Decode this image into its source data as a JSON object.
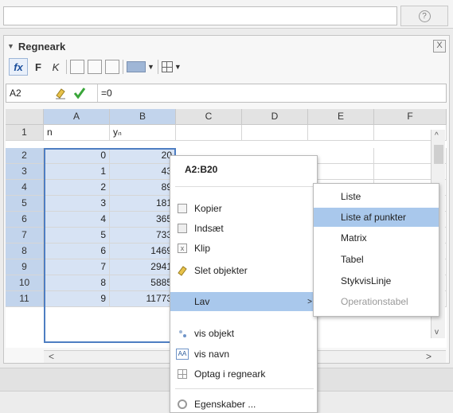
{
  "topbar": {
    "help_symbol": "?"
  },
  "panel": {
    "title": "Regneark",
    "close_symbol": "X",
    "toolbar": {
      "fx": "fx",
      "bold": "F",
      "italic": "K"
    }
  },
  "inputbar": {
    "cell_ref": "A2",
    "content": "=0"
  },
  "grid": {
    "columns": [
      "A",
      "B",
      "C",
      "D",
      "E",
      "F"
    ],
    "header_row": {
      "row": "1",
      "a": "n",
      "b": "yₙ"
    },
    "rows": [
      {
        "row": "2",
        "a": "0",
        "b": "20"
      },
      {
        "row": "3",
        "a": "1",
        "b": "43"
      },
      {
        "row": "4",
        "a": "2",
        "b": "89"
      },
      {
        "row": "5",
        "a": "3",
        "b": "181"
      },
      {
        "row": "6",
        "a": "4",
        "b": "365"
      },
      {
        "row": "7",
        "a": "5",
        "b": "733"
      },
      {
        "row": "8",
        "a": "6",
        "b": "1469"
      },
      {
        "row": "9",
        "a": "7",
        "b": "2941"
      },
      {
        "row": "10",
        "a": "8",
        "b": "5885"
      },
      {
        "row": "11",
        "a": "9",
        "b": "11773"
      }
    ]
  },
  "context_menu": {
    "header": "A2:B20",
    "items": {
      "kopier": "Kopier",
      "indsaet": "Indsæt",
      "klip": "Klip",
      "slet": "Slet objekter",
      "lav": "Lav",
      "vis_objekt": "vis objekt",
      "vis_navn": "vis navn",
      "optag": "Optag i regneark",
      "egenskaber": "Egenskaber ..."
    }
  },
  "submenu": {
    "items": [
      "Liste",
      "Liste af punkter",
      "Matrix",
      "Tabel",
      "StykvisLinje",
      "Operationstabel"
    ]
  },
  "colors": {
    "selection": "#d7e3f4",
    "highlight": "#a9c8ec",
    "selection_border": "#4e7ec2"
  }
}
